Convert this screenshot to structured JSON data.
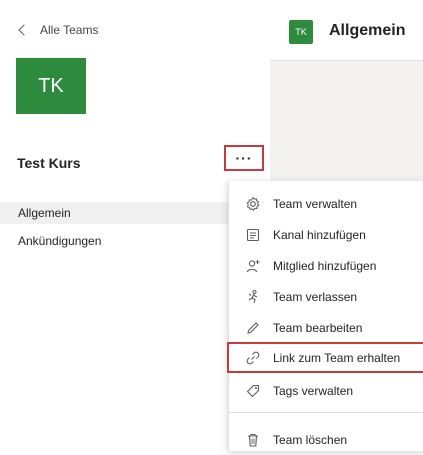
{
  "sidebar": {
    "back_label": "Alle Teams",
    "avatar_initials": "TK",
    "team_name": "Test Kurs",
    "more_label": "···",
    "channels": [
      {
        "label": "Allgemein"
      },
      {
        "label": "Ankündigungen"
      }
    ]
  },
  "header": {
    "avatar_initials": "TK",
    "title": "Allgemein"
  },
  "menu": {
    "items": [
      {
        "label": "Team verwalten",
        "icon": "gear-icon"
      },
      {
        "label": "Kanal hinzufügen",
        "icon": "channel-icon"
      },
      {
        "label": "Mitglied hinzufügen",
        "icon": "add-person-icon"
      },
      {
        "label": "Team verlassen",
        "icon": "leave-icon"
      },
      {
        "label": "Team bearbeiten",
        "icon": "pencil-icon"
      },
      {
        "label": "Link zum Team erhalten",
        "icon": "link-icon"
      },
      {
        "label": "Tags verwalten",
        "icon": "tag-icon"
      },
      {
        "label": "Team löschen",
        "icon": "trash-icon"
      }
    ]
  },
  "colors": {
    "accent_green": "#2e8b3e",
    "highlight_red": "#c23b3f"
  }
}
